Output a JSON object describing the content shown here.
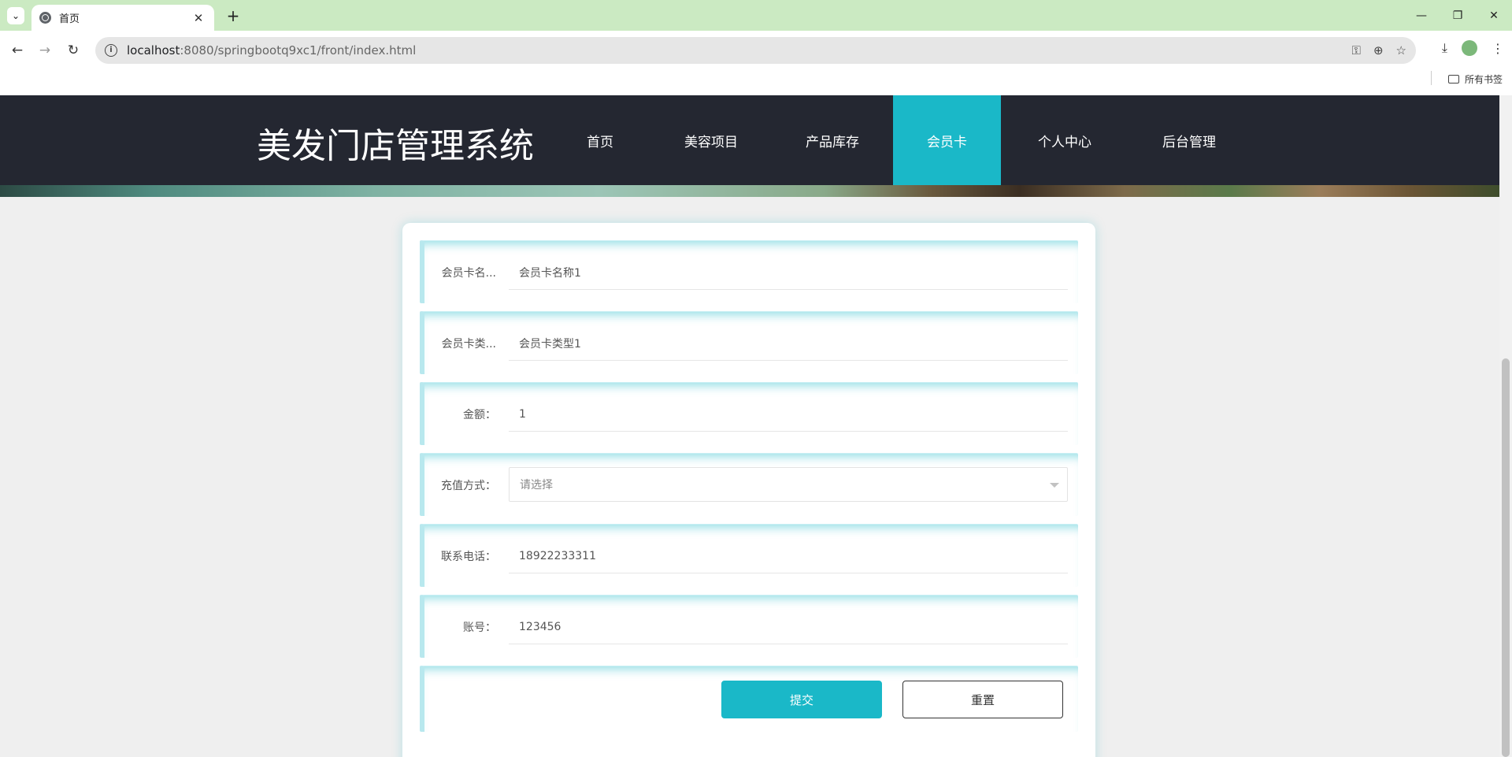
{
  "browser": {
    "tab_title": "首页",
    "url_host": "localhost",
    "url_path": ":8080/springbootq9xc1/front/index.html",
    "bookmarks_label": "所有书签"
  },
  "site": {
    "title": "美发门店管理系统",
    "nav": [
      "首页",
      "美容项目",
      "产品库存",
      "会员卡",
      "个人中心",
      "后台管理"
    ],
    "active_nav": "会员卡",
    "accent_color": "#1ab8c8"
  },
  "form": {
    "fields": [
      {
        "label": "会员卡名...",
        "value": "会员卡名称1"
      },
      {
        "label": "会员卡类...",
        "value": "会员卡类型1"
      },
      {
        "label": "金额：",
        "value": "1"
      },
      {
        "label": "充值方式：",
        "placeholder": "请选择"
      },
      {
        "label": "联系电话：",
        "value": "18922233311"
      },
      {
        "label": "账号：",
        "value": "123456"
      }
    ],
    "submit_label": "提交",
    "reset_label": "重置"
  }
}
